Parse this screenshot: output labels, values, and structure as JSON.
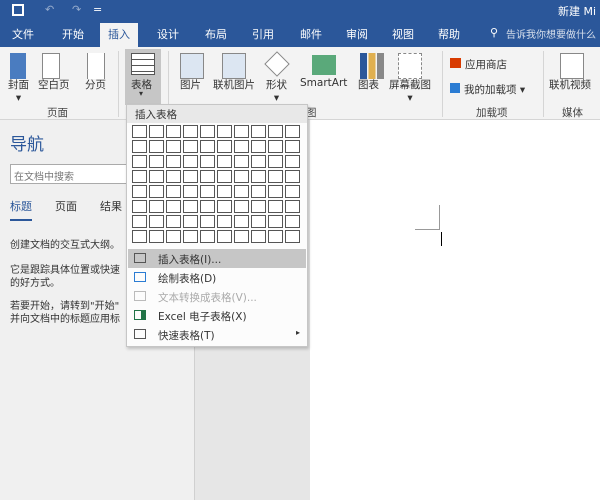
{
  "title": "新建 Mi",
  "quick_access": {
    "save": "save-icon",
    "undo": "↶",
    "redo": "↷",
    "more": "="
  },
  "tabs": [
    "文件",
    "开始",
    "插入",
    "设计",
    "布局",
    "引用",
    "邮件",
    "审阅",
    "视图",
    "帮助"
  ],
  "active_tab": "插入",
  "tell_me": "告诉我你想要做什么",
  "ribbon": {
    "pages": {
      "buttons": [
        "封面",
        "空白页",
        "分页"
      ],
      "label": "页面"
    },
    "table_button": "表格",
    "illustrations": {
      "buttons": [
        "图片",
        "联机图片",
        "形状",
        "SmartArt",
        "图表",
        "屏幕截图"
      ],
      "label_partial": "图"
    },
    "addins": {
      "buttons": [
        "应用商店",
        "我的加载项"
      ],
      "label": "加载项"
    },
    "media": {
      "buttons": [
        "联机视频"
      ],
      "label": "媒体"
    }
  },
  "table_menu": {
    "header": "插入表格",
    "grid": {
      "columns": 10,
      "rows": 8
    },
    "items": [
      {
        "label": "插入表格(I)...",
        "enabled": true,
        "highlighted": true
      },
      {
        "label": "绘制表格(D)",
        "enabled": true
      },
      {
        "label": "文本转换成表格(V)...",
        "enabled": false
      },
      {
        "label": "Excel 电子表格(X)",
        "enabled": true
      },
      {
        "label": "快速表格(T)",
        "enabled": true,
        "submenu": "▸"
      }
    ]
  },
  "nav": {
    "title": "导航",
    "search_placeholder": "在文档中搜索",
    "tabs": [
      "标题",
      "页面",
      "结果"
    ],
    "p1": "创建文档的交互式大纲。",
    "p2a": "它是跟踪具体位置或快速",
    "p2b": "的好方式。",
    "p3a": "若要开始，请转到\"开始\"",
    "p3b": "并向文档中的标题应用标"
  },
  "colors": {
    "accent": "#2b579a"
  }
}
